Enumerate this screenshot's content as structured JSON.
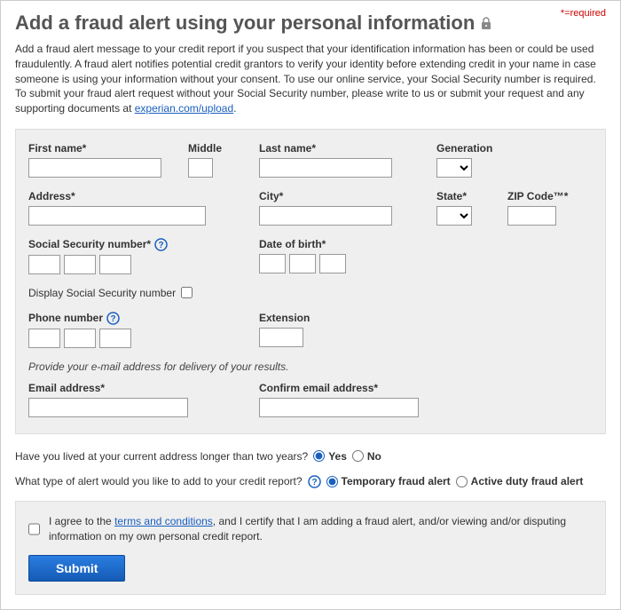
{
  "required_note": "*=required",
  "title": "Add a fraud alert using your personal information",
  "intro_text": "Add a fraud alert message to your credit report if you suspect that your identification information has been or could be used fraudulently. A fraud alert notifies potential credit grantors to verify your identity before extending credit in your name in case someone is using your information without your consent. To use our online service, your Social Security number is required. To submit your fraud alert request without your Social Security number, please write to us or submit your request and any supporting documents at ",
  "intro_link": "experian.com/upload",
  "labels": {
    "first_name": "First name*",
    "middle": "Middle",
    "last_name": "Last name*",
    "generation": "Generation",
    "address": "Address*",
    "city": "City*",
    "state": "State*",
    "zip": "ZIP Code™*",
    "ssn": "Social Security number*",
    "dob": "Date of birth*",
    "display_ssn": "Display Social Security number",
    "phone": "Phone number",
    "extension": "Extension",
    "email_hint": "Provide your e-mail address for delivery of your results.",
    "email": "Email address*",
    "confirm_email": "Confirm email address*"
  },
  "q1": {
    "text": "Have you lived at your current address longer than two years?",
    "yes": "Yes",
    "no": "No"
  },
  "q2": {
    "text": "What type of alert would you like to add to your credit report?",
    "opt1": "Temporary fraud alert",
    "opt2": "Active duty fraud alert"
  },
  "agree": {
    "pre": "I agree to the ",
    "link": "terms and conditions",
    "post": ", and I certify that I am adding a fraud alert, and/or viewing and/or disputing information on my own personal credit report."
  },
  "submit": "Submit"
}
